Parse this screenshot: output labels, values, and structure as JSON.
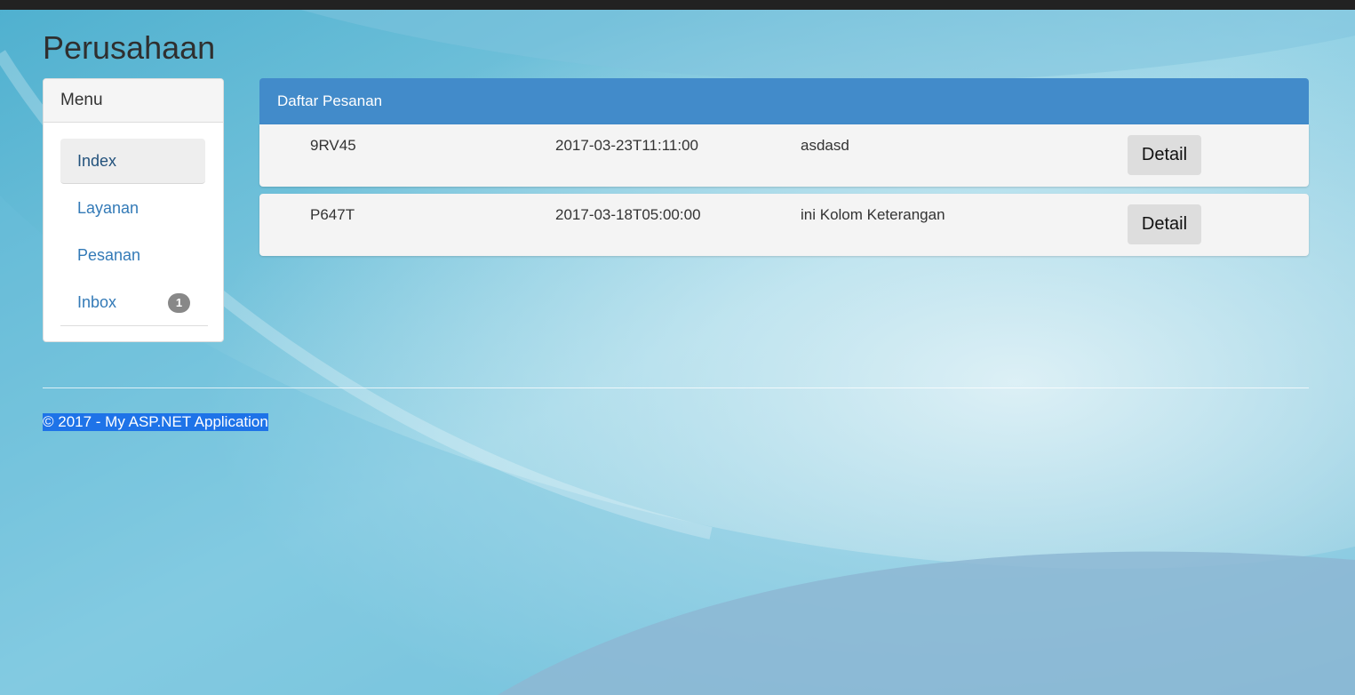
{
  "page": {
    "title": "Perusahaan"
  },
  "menu": {
    "heading": "Menu",
    "items": [
      {
        "label": "Index",
        "active": true
      },
      {
        "label": "Layanan"
      },
      {
        "label": "Pesanan"
      },
      {
        "label": "Inbox",
        "badge": "1"
      }
    ]
  },
  "orders": {
    "title": "Daftar Pesanan",
    "detail_label": "Detail",
    "rows": [
      {
        "code": "9RV45",
        "date": "2017-03-23T11:11:00",
        "note": "asdasd",
        "button": "Detail"
      },
      {
        "code": "P647T",
        "date": "2017-03-18T05:00:00",
        "note": "ini Kolom Keterangan",
        "button": "Detail"
      }
    ]
  },
  "footer": {
    "text": "© 2017 - My ASP.NET Application"
  },
  "colors": {
    "panel_header": "#428bca",
    "link": "#337ab7",
    "topbar": "#222222",
    "selection": "#1e73e8"
  }
}
